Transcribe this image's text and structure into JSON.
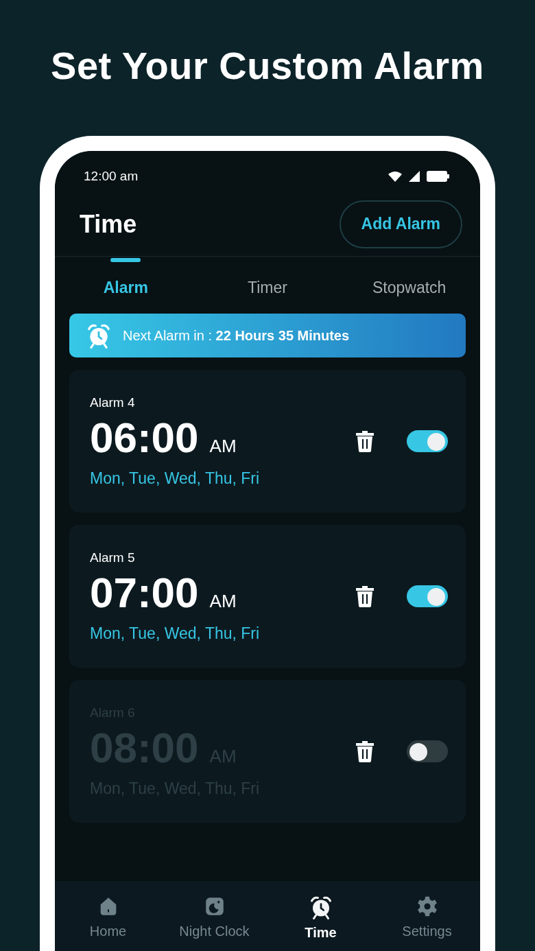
{
  "headline": "Set Your Custom Alarm",
  "status_bar": {
    "time": "12:00 am"
  },
  "header": {
    "title": "Time",
    "action": "Add Alarm"
  },
  "tabs": [
    {
      "label": "Alarm",
      "selected": true
    },
    {
      "label": "Timer",
      "selected": false
    },
    {
      "label": "Stopwatch",
      "selected": false
    }
  ],
  "banner": {
    "text": "Next Alarm in :  **22 Hours 35 Minutes**"
  },
  "alarms": [
    {
      "name": "Alarm 4",
      "time": "06:00",
      "period": "AM",
      "days": "Mon, Tue, Wed, Thu, Fri",
      "enabled": true
    },
    {
      "name": "Alarm 5",
      "time": "07:00",
      "period": "AM",
      "days": "Mon, Tue, Wed, Thu, Fri",
      "enabled": true
    },
    {
      "name": "Alarm 6",
      "time": "08:00",
      "period": "AM",
      "days": "Mon, Tue, Wed, Thu, Fri",
      "enabled": false
    }
  ],
  "nav": [
    {
      "kind": "home",
      "label": "Home",
      "selected": false
    },
    {
      "kind": "night",
      "label": "Night Clock",
      "selected": false
    },
    {
      "kind": "alarm",
      "label": "Time",
      "selected": true
    },
    {
      "kind": "settings",
      "label": "Settings",
      "selected": false
    }
  ]
}
